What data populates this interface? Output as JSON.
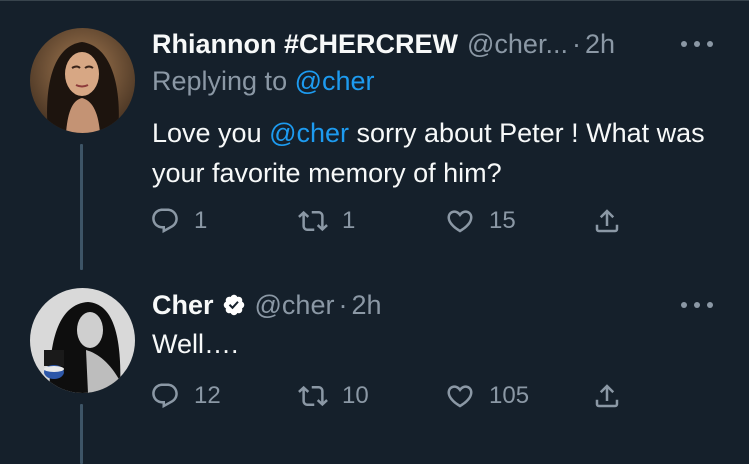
{
  "tweets": [
    {
      "name": "Rhiannon #CHERCREW",
      "handle": "@cher...",
      "time": "2h",
      "reply_prefix": "Replying to",
      "reply_to": "@cher",
      "text_before": "Love you ",
      "text_mention": "@cher",
      "text_after": " sorry about Peter ! What was your favorite memory of him?",
      "replies": "1",
      "retweets": "1",
      "likes": "15"
    },
    {
      "name": "Cher",
      "verified": true,
      "handle": "@cher",
      "time": "2h",
      "text": "Well….",
      "replies": "12",
      "retweets": "10",
      "likes": "105"
    }
  ],
  "theme": {
    "background": "#15202b",
    "text": "#f7f9f9",
    "muted": "#8b98a5",
    "link": "#1d9bf0"
  },
  "icons": [
    "reply-icon",
    "retweet-icon",
    "like-icon",
    "share-icon",
    "more-icon",
    "verified-badge-icon"
  ]
}
